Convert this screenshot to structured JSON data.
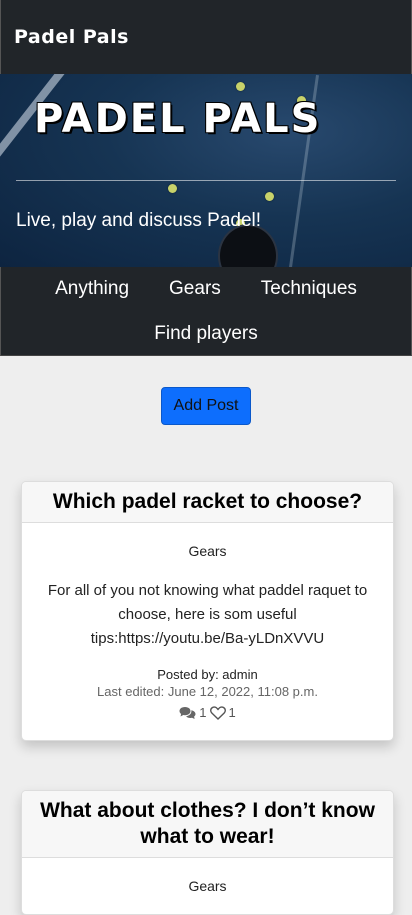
{
  "nav": {
    "brand": "Padel Pals"
  },
  "hero": {
    "title": "PADEL PALS",
    "tagline": "Live, play and discuss Padel!"
  },
  "categories": [
    "Anything",
    "Gears",
    "Techniques",
    "Find players"
  ],
  "actions": {
    "add_post": "Add Post"
  },
  "posts": [
    {
      "title": "Which padel racket to choose?",
      "category": "Gears",
      "content": "For all of you not knowing what paddel raquet to choose, here is som useful tips:https://youtu.be/Ba-yLDnXVVU",
      "author": "Posted by: admin",
      "edited": "Last edited: June 12, 2022, 11:08 p.m.",
      "comments": "1",
      "likes": "1"
    },
    {
      "title": "What about clothes? I don’t know what to wear!",
      "category": "Gears"
    }
  ]
}
